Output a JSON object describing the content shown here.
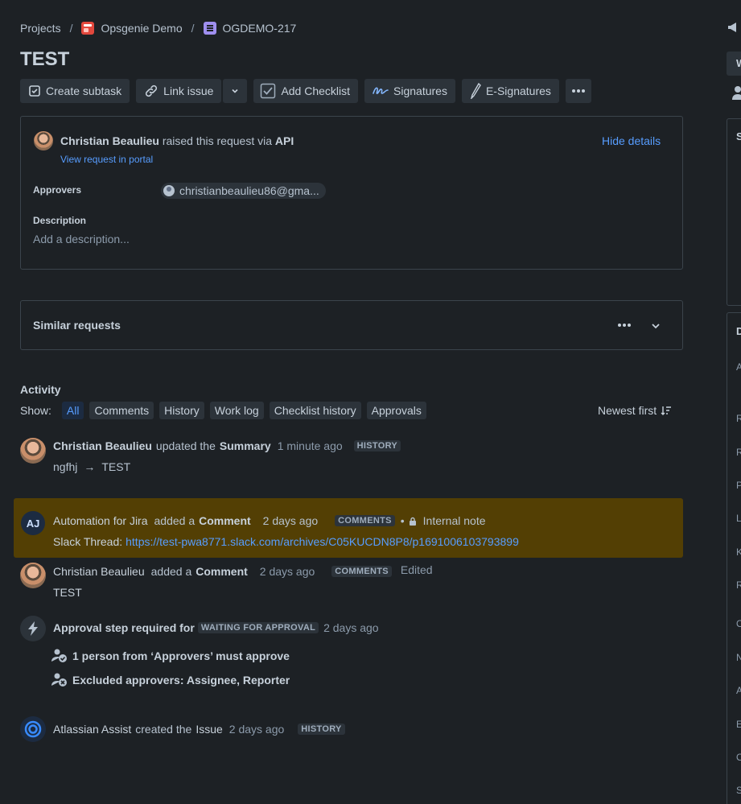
{
  "breadcrumb": {
    "projects": "Projects",
    "sep": "/",
    "project": "Opsgenie Demo",
    "issue_key": "OGDEMO-217"
  },
  "issue": {
    "title": "TEST"
  },
  "toolbar": {
    "create_subtask": "Create subtask",
    "link_issue": "Link issue",
    "add_checklist": "Add Checklist",
    "signatures": "Signatures",
    "esignatures": "E-Signatures"
  },
  "details": {
    "requester": "Christian Beaulieu",
    "raised_text": "raised this request via",
    "channel": "API",
    "view_portal": "View request in portal",
    "hide_details": "Hide details",
    "approvers_label": "Approvers",
    "approver": "christianbeaulieu86@gma...",
    "description_label": "Description",
    "description_placeholder": "Add a description..."
  },
  "similar": {
    "title": "Similar requests"
  },
  "activity": {
    "heading": "Activity",
    "show_label": "Show:",
    "filters": [
      "All",
      "Comments",
      "History",
      "Work log",
      "Checklist history",
      "Approvals"
    ],
    "sort": "Newest first",
    "entries": [
      {
        "author": "Christian Beaulieu",
        "action": "updated the",
        "target": "Summary",
        "time": "1 minute ago",
        "badge": "HISTORY",
        "old": "ngfhj",
        "arrow": "→",
        "new": "TEST"
      },
      {
        "author": "Automation for Jira",
        "initials": "AJ",
        "action": "added a",
        "target": "Comment",
        "time": "2 days ago",
        "badge": "COMMENTS",
        "dot": "•",
        "note": "Internal note",
        "body_prefix": "Slack Thread:",
        "link": "https://test-pwa8771.slack.com/archives/C05KUCDN8P8/p1691006103793899"
      },
      {
        "author": "Christian Beaulieu",
        "action": "added a",
        "target": "Comment",
        "time": "2 days ago",
        "badge": "COMMENTS",
        "edited": "Edited",
        "body": "TEST"
      },
      {
        "title": "Approval step required for",
        "status": "WAITING FOR APPROVAL",
        "time": "2 days ago",
        "line1": "1 person from ‘Approvers’ must approve",
        "line2": "Excluded approvers: Assignee, Reporter"
      },
      {
        "author": "Atlassian Assist",
        "action": "created the",
        "target": "Issue",
        "time": "2 days ago",
        "badge": "HISTORY"
      }
    ]
  },
  "right_panel": {
    "letters": [
      "W",
      "S",
      "D",
      "A",
      "R",
      "R",
      "P",
      "L",
      "K",
      "R",
      "O",
      "N",
      "A",
      "E",
      "O",
      "S"
    ]
  },
  "colors": {
    "background": "#1d2125",
    "link": "#579dff",
    "highlight": "#533f04",
    "project_icon": "#e2483d",
    "issue_icon": "#9f8fef"
  }
}
